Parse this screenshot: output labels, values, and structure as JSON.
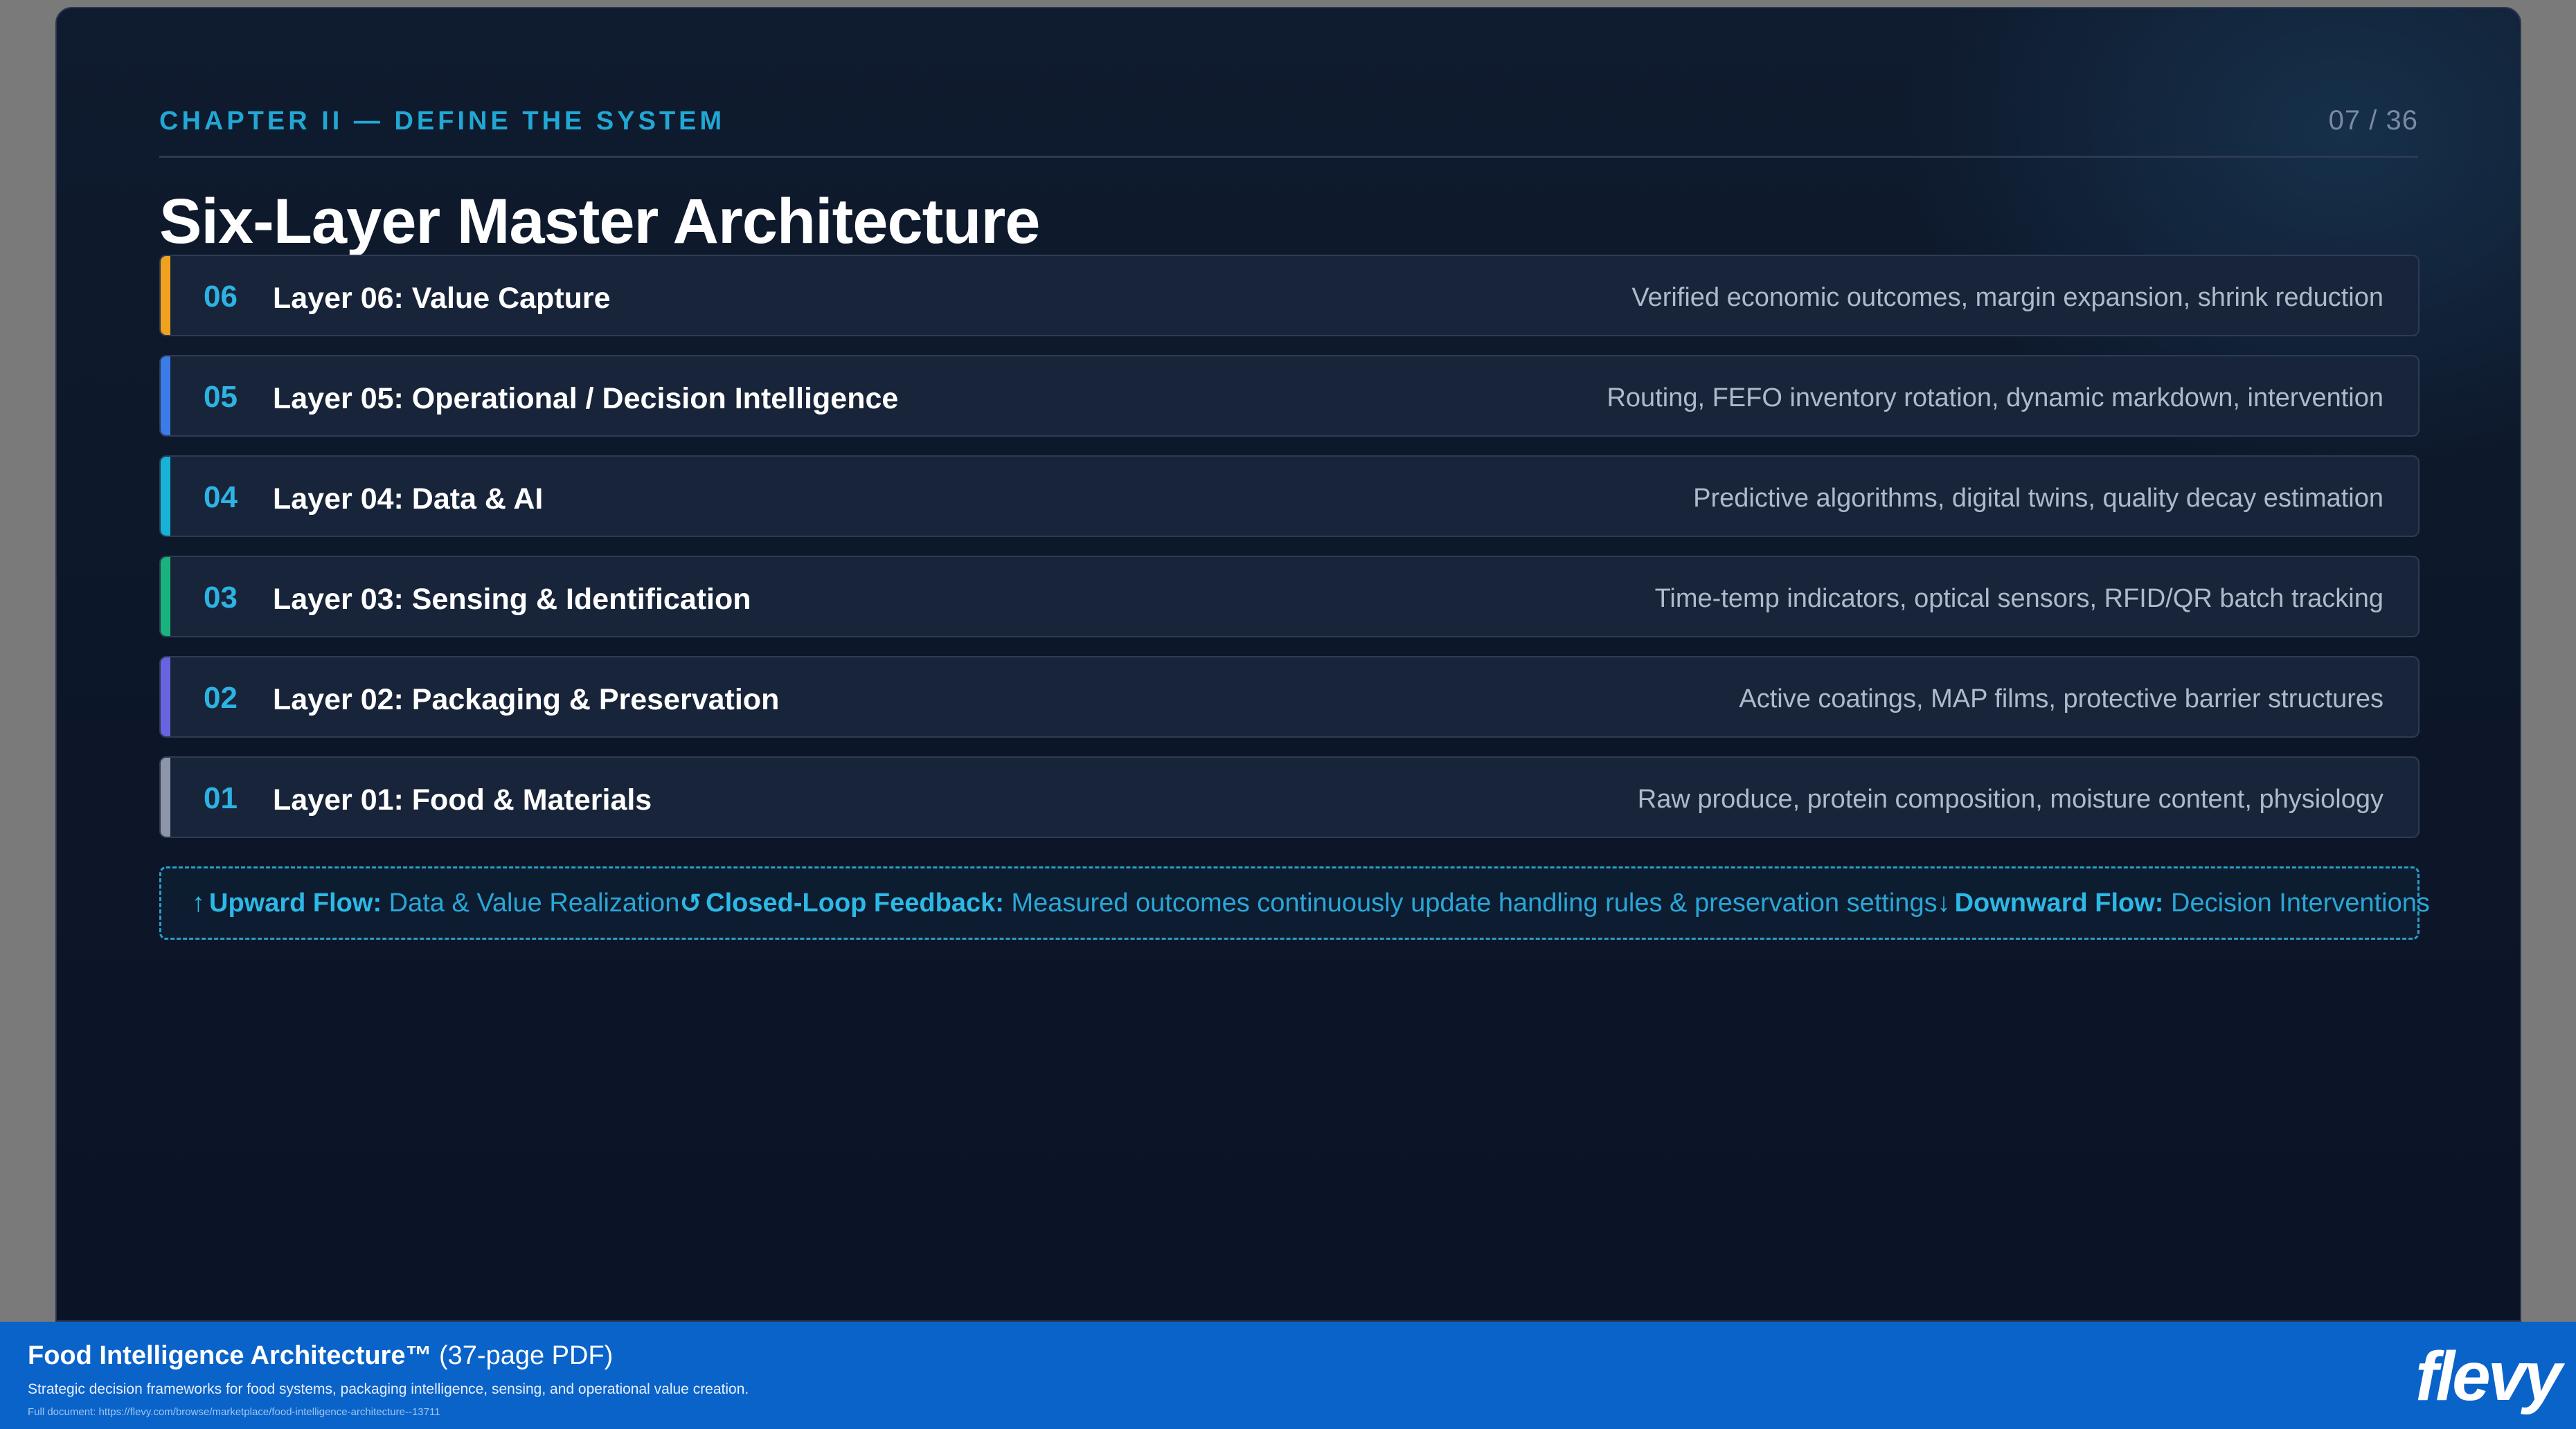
{
  "slide": {
    "chapter": "CHAPTER II — DEFINE THE SYSTEM",
    "page": "07 / 36",
    "title": "Six-Layer Master Architecture",
    "layers": [
      {
        "num": "06",
        "name": "Layer 06: Value Capture",
        "desc": "Verified economic outcomes, margin expansion, shrink reduction",
        "color": "#f0a21e"
      },
      {
        "num": "05",
        "name": "Layer 05: Operational / Decision Intelligence",
        "desc": "Routing, FEFO inventory rotation, dynamic markdown, intervention",
        "color": "#3a7ce8"
      },
      {
        "num": "04",
        "name": "Layer 04: Data & AI",
        "desc": "Predictive algorithms, digital twins, quality decay estimation",
        "color": "#16b3d6"
      },
      {
        "num": "03",
        "name": "Layer 03: Sensing & Identification",
        "desc": "Time-temp indicators, optical sensors, RFID/QR batch tracking",
        "color": "#19b37e"
      },
      {
        "num": "02",
        "name": "Layer 02: Packaging & Preservation",
        "desc": "Active coatings, MAP films, protective barrier structures",
        "color": "#6a63e0"
      },
      {
        "num": "01",
        "name": "Layer 01: Food & Materials",
        "desc": "Raw produce, protein composition, moisture content, physiology",
        "color": "#8d96a8"
      }
    ],
    "flow": {
      "upward_icon": "↑",
      "upward_key": "Upward Flow:",
      "upward_value": "Data & Value Realization",
      "loop_icon": "↺",
      "loop_key": "Closed-Loop Feedback:",
      "loop_value": "Measured outcomes continuously update handling rules & preservation settings",
      "down_icon": "↓",
      "down_key": "Downward Flow:",
      "down_value": "Decision Interventions"
    }
  },
  "footer": {
    "title_bold": "Food Intelligence Architecture™",
    "title_rest": " (37-page PDF)",
    "subtitle": "Strategic decision frameworks for food systems, packaging intelligence, sensing, and operational value creation.",
    "url": "Full document: https://flevy.com/browse/marketplace/food-intelligence-architecture--13711",
    "logo": "flevy"
  }
}
